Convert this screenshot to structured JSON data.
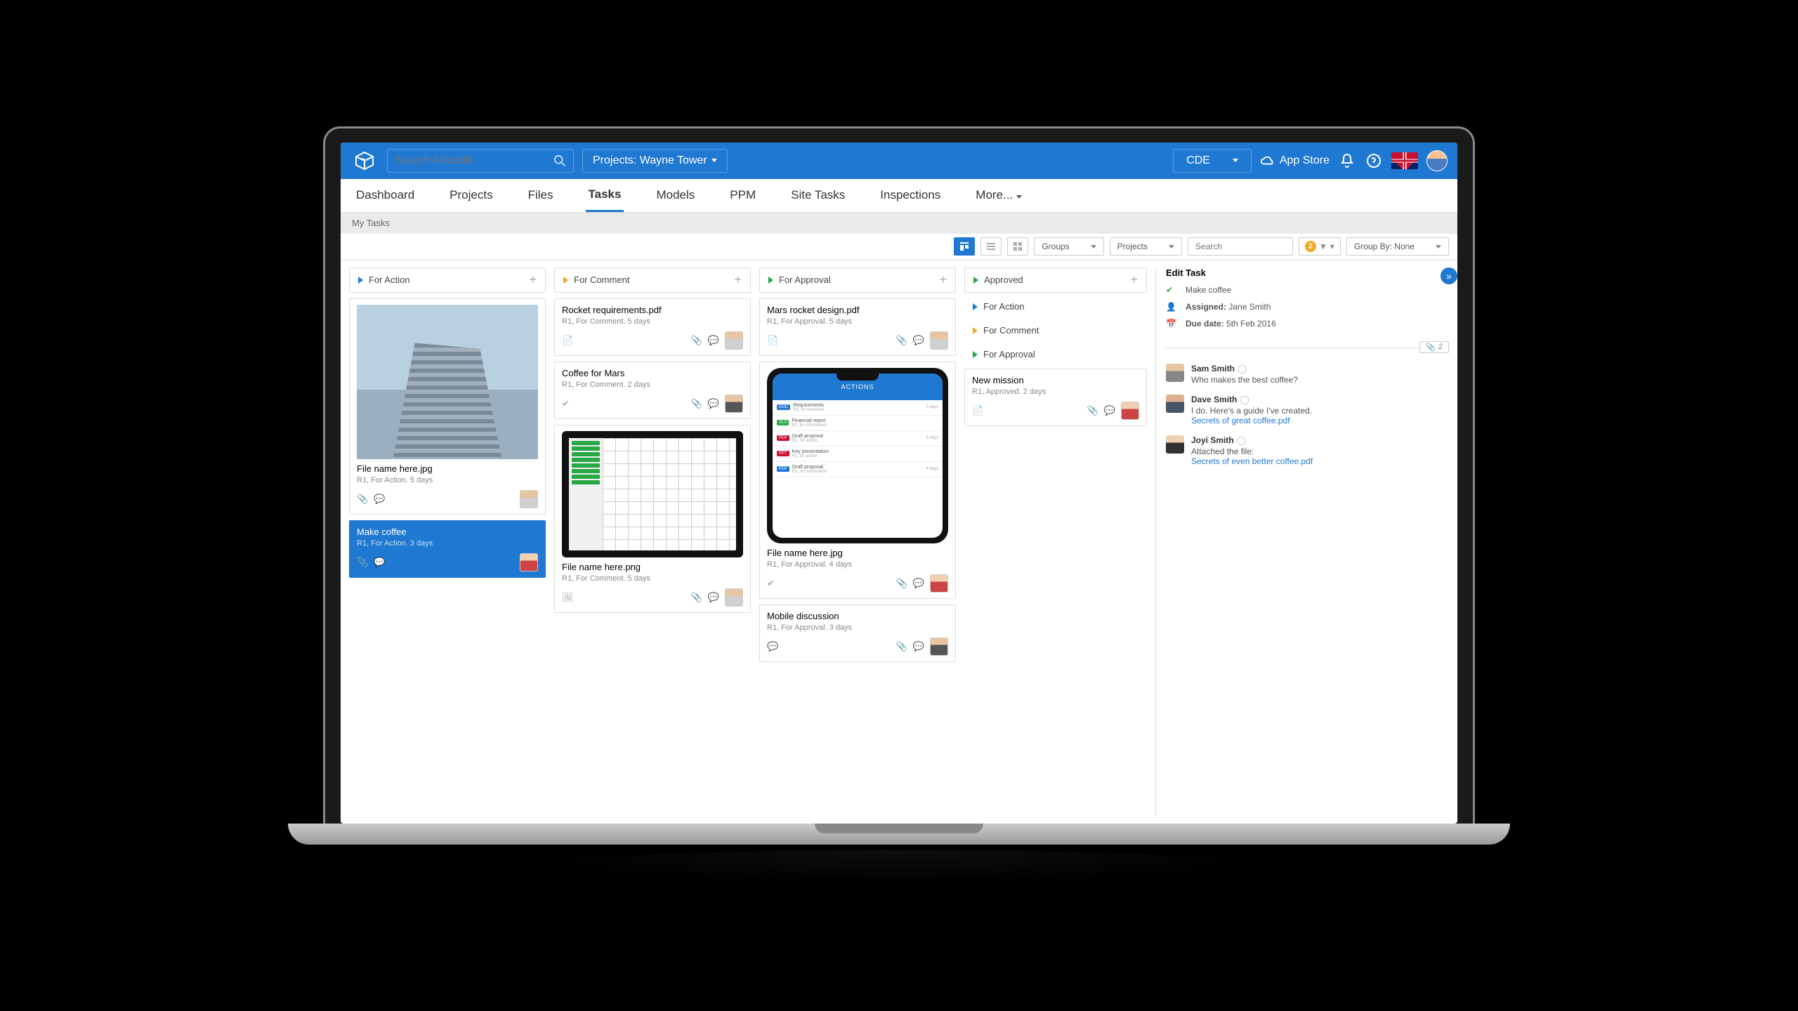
{
  "topbar": {
    "search_placeholder": "Search Adoddle",
    "project_selector": "Projects: Wayne Tower",
    "cde_label": "CDE",
    "appstore": "App Store"
  },
  "nav": {
    "items": [
      "Dashboard",
      "Projects",
      "Files",
      "Tasks",
      "Models",
      "PPM",
      "Site Tasks",
      "Inspections",
      "More..."
    ],
    "active": "Tasks"
  },
  "subhead": "My Tasks",
  "toolbar": {
    "groups": "Groups",
    "projects": "Projects",
    "search_placeholder": "Search",
    "badge_count": "2",
    "groupby": "Group By: None"
  },
  "columns": {
    "action": {
      "title": "For Action",
      "cards": [
        {
          "title": "File name here.jpg",
          "meta": "R1, For Action. 5 days"
        },
        {
          "title": "Make coffee",
          "meta": "R1, For Action. 3 days"
        }
      ]
    },
    "comment": {
      "title": "For Comment",
      "cards": [
        {
          "title": "Rocket requirements.pdf",
          "meta": "R1, For Comment. 5 days"
        },
        {
          "title": "Coffee for Mars",
          "meta": "R1, For Comment. 2 days"
        },
        {
          "title": "File name here.png",
          "meta": "R1, For Comment. 5 days"
        }
      ]
    },
    "approval": {
      "title": "For Approval",
      "cards": [
        {
          "title": "Mars rocket design.pdf",
          "meta": "R1, For Approval. 5 days"
        },
        {
          "title": "File name here.jpg",
          "meta": "R1, For Approval. 4 days"
        },
        {
          "title": "Mobile discussion",
          "meta": "R1, For Approval. 3 days"
        }
      ]
    },
    "approved": {
      "title": "Approved",
      "subheads": [
        "For Action",
        "For Comment",
        "For Approval"
      ],
      "card": {
        "title": "New mission",
        "meta": "R1, Approved. 2 days"
      }
    }
  },
  "phone": {
    "header": "ACTIONS",
    "rows": [
      {
        "tag": "DOC",
        "color": "#1f78d1",
        "t": "Requirements",
        "sub": "R1, for comment",
        "d": "2 days"
      },
      {
        "tag": "XLS",
        "color": "#28a745",
        "t": "Financial report",
        "sub": "R2, for information",
        "d": ""
      },
      {
        "tag": "PDF",
        "color": "#c8102e",
        "t": "Draft proposal",
        "sub": "R1, for action",
        "d": "3 days"
      },
      {
        "tag": "PPT",
        "color": "#c8102e",
        "t": "Key presentation",
        "sub": "R1, for action",
        "d": ""
      },
      {
        "tag": "PDF",
        "color": "#1f78d1",
        "t": "Draft proposal",
        "sub": "R1, for information",
        "d": "4 days"
      }
    ]
  },
  "panel": {
    "heading": "Edit Task",
    "task_title": "Make coffee",
    "assigned_label": "Assigned:",
    "assigned_value": "Jane Smith",
    "due_label": "Due date:",
    "due_value": "5th Feb 2016",
    "attach_count": "2",
    "comments": [
      {
        "name": "Sam Smith",
        "body": "Who makes the best coffee?"
      },
      {
        "name": "Dave Smith",
        "body": "I do. Here's a guide I've created.",
        "link": "Secrets of great coffee.pdf"
      },
      {
        "name": "Joyi Smith",
        "body": "Attached the file:",
        "link": "Secrets of even better coffee.pdf"
      }
    ]
  }
}
